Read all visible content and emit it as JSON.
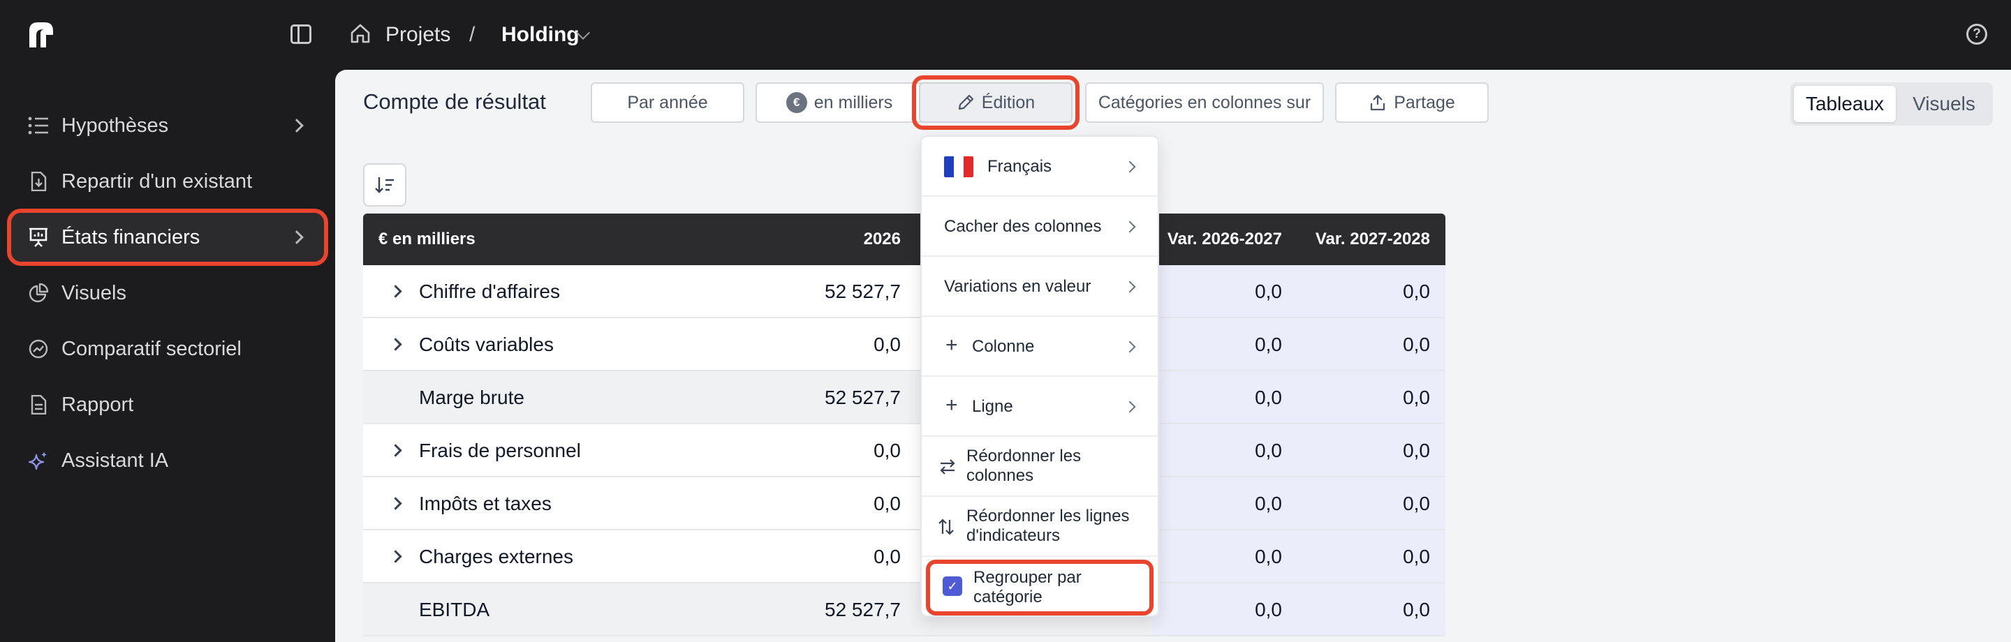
{
  "topbar": {
    "breadcrumb_projects": "Projets",
    "breadcrumb_separator": "/",
    "breadcrumb_project": "Holding"
  },
  "sidebar": {
    "items": [
      {
        "label": "Hypothèses",
        "icon": "list-icon",
        "has_chevron": true
      },
      {
        "label": "Repartir d'un existant",
        "icon": "file-download-icon",
        "has_chevron": false
      },
      {
        "label": "États financiers",
        "icon": "presentation-chart-icon",
        "has_chevron": true,
        "active": true
      },
      {
        "label": "Visuels",
        "icon": "pie-chart-icon",
        "has_chevron": false
      },
      {
        "label": "Comparatif sectoriel",
        "icon": "trending-icon",
        "has_chevron": false
      },
      {
        "label": "Rapport",
        "icon": "document-icon",
        "has_chevron": false
      },
      {
        "label": "Assistant IA",
        "icon": "sparkles-icon",
        "has_chevron": false
      }
    ]
  },
  "toolbar": {
    "title": "Compte de résultat",
    "per_year": "Par année",
    "unit_badge": "€",
    "unit": "en milliers",
    "edit": "Édition",
    "categories": "Catégories en colonnes sur",
    "share": "Partage",
    "view_tables": "Tableaux",
    "view_visuals": "Visuels"
  },
  "table": {
    "headers": [
      "€ en milliers",
      "2026",
      "Var. 2026-2027",
      "Var. 2027-2028"
    ],
    "rows": [
      {
        "label": "Chiffre d'affaires",
        "expandable": true,
        "y2026": "52 527,7",
        "var1": "0,0",
        "var2": "0,0"
      },
      {
        "label": "Coûts variables",
        "expandable": true,
        "y2026": "0,0",
        "var1": "0,0",
        "var2": "0,0"
      },
      {
        "label": "Marge brute",
        "expandable": false,
        "y2026": "52 527,7",
        "var1": "0,0",
        "var2": "0,0"
      },
      {
        "label": "Frais de personnel",
        "expandable": true,
        "y2026": "0,0",
        "var1": "0,0",
        "var2": "0,0"
      },
      {
        "label": "Impôts et taxes",
        "expandable": true,
        "y2026": "0,0",
        "var1": "0,0",
        "var2": "0,0"
      },
      {
        "label": "Charges externes",
        "expandable": true,
        "y2026": "0,0",
        "var1": "0,0",
        "var2": "0,0"
      },
      {
        "label": "EBITDA",
        "expandable": false,
        "y2026": "52 527,7",
        "var1": "0,0",
        "var2": "0,0"
      }
    ]
  },
  "dropdown": {
    "language": "Français",
    "hide_columns": "Cacher des colonnes",
    "variations": "Variations en valeur",
    "column": "Colonne",
    "row": "Ligne",
    "reorder_columns_1": "Réordonner les",
    "reorder_columns_2": "colonnes",
    "reorder_rows_1": "Réordonner les lignes",
    "reorder_rows_2": "d'indicateurs",
    "group_1": "Regrouper par",
    "group_2": "catégorie",
    "group_checked": true,
    "check_mark": "✓"
  },
  "colors": {
    "accent_outline": "#e8452c",
    "checkbox": "#4f5bd5",
    "highlight_column": "#ecedfb",
    "dark_bg": "#1c1c1e"
  }
}
